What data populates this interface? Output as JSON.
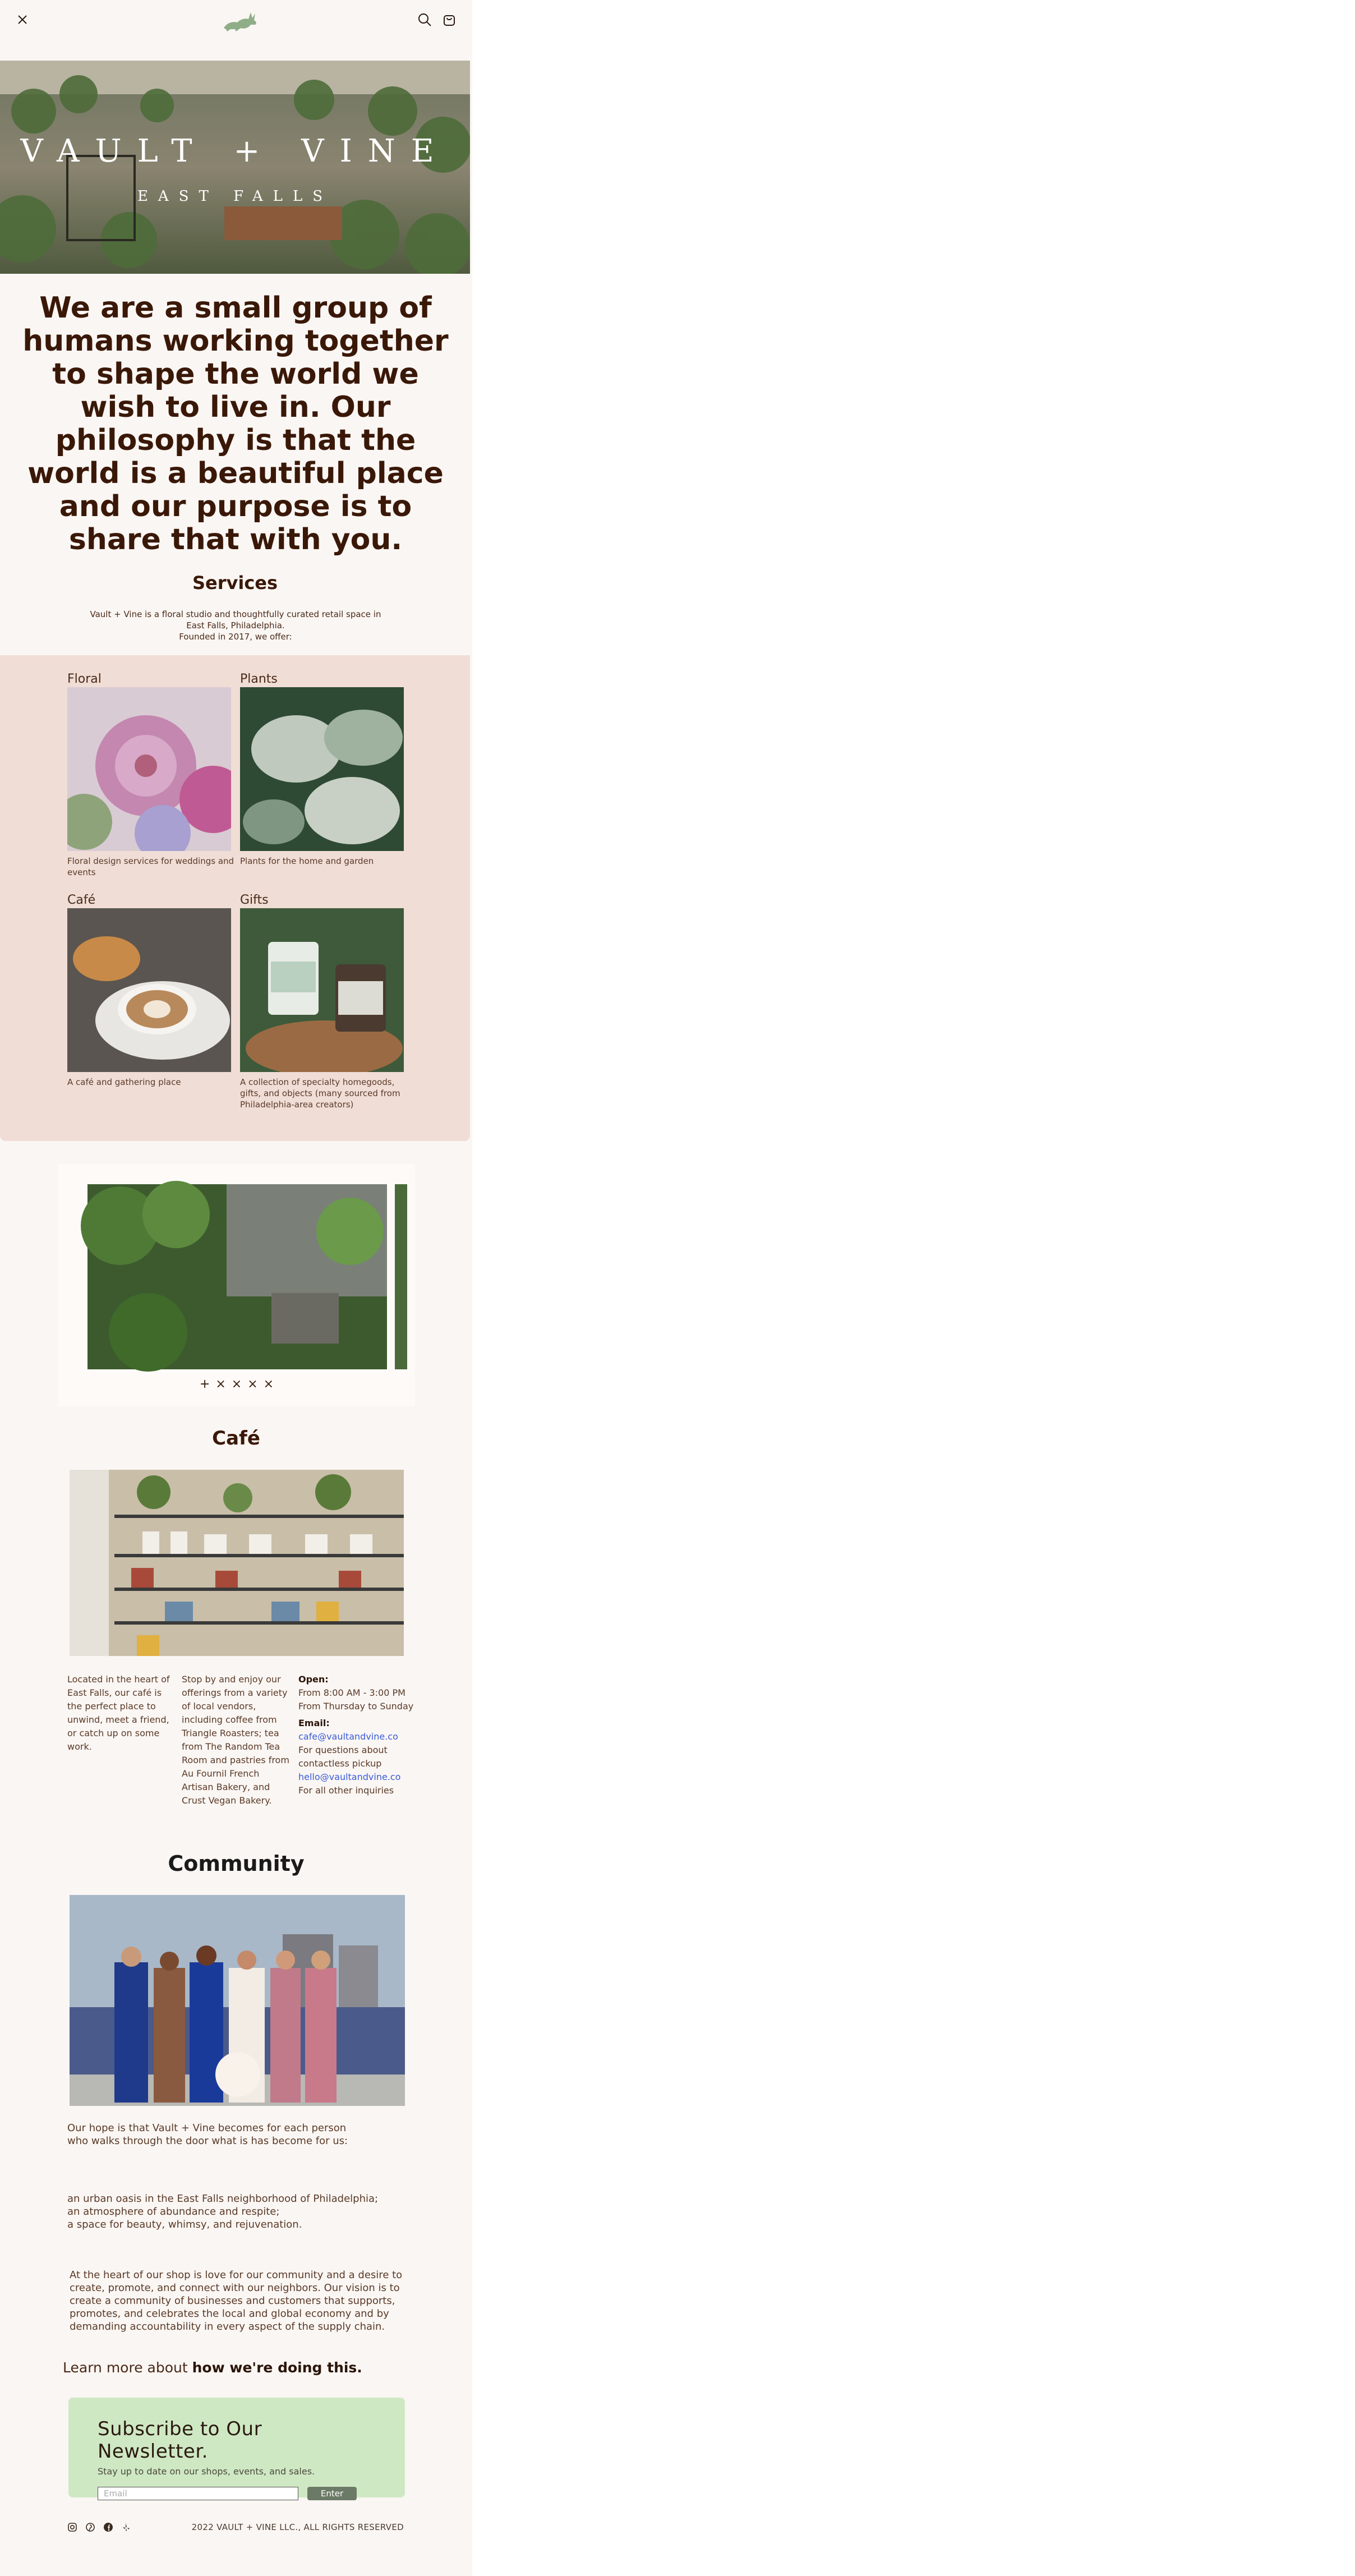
{
  "header": {
    "logo": "rabbit-logo",
    "menu_icon": "close-icon",
    "search_icon": "search-icon",
    "cart_icon": "cart-icon"
  },
  "hero": {
    "title": "VAULT + VINE",
    "subtitle": "EAST FALLS"
  },
  "mission": "We are a small group of humans working together to shape the world we wish to live in. Our philosophy is that the world is a beautiful place and our purpose is to share that with you.",
  "services": {
    "title": "Services",
    "intro_line1": "Vault + Vine is a floral studio and thoughtfully curated retail space in",
    "intro_line2": "East Falls, Philadelphia.",
    "intro_line3": "Founded in 2017, we offer:",
    "items": [
      {
        "label": "Floral",
        "desc": "Floral design services for weddings and events"
      },
      {
        "label": "Plants",
        "desc": "Plants for the home and garden"
      },
      {
        "label": "Café",
        "desc": "A café and gathering place"
      },
      {
        "label": "Gifts",
        "desc": "A collection of specialty homegoods, gifts, and objects (many sourced from Philadelphia-area creators)"
      }
    ]
  },
  "gallery": {
    "dots": [
      "+",
      "×",
      "×",
      "×",
      "×"
    ]
  },
  "cafe": {
    "title": "Café",
    "col1": "Located in the heart of East Falls, our café is the perfect place to unwind, meet a friend, or catch up on some work.",
    "col2": "Stop by and enjoy our offerings from a variety of local vendors, including coffee from Triangle Roasters; tea from The Random Tea Room and pastries from Au Fournil French Artisan Bakery, and Crust Vegan Bakery.",
    "open_label": "Open:",
    "hours1": "From 8:00 AM - 3:00 PM",
    "hours2": "From Thursday to Sunday",
    "email_label": "Email:",
    "email1": "cafe@vaultandvine.co",
    "email1_note": "For questions about contactless pickup",
    "email2": "hello@vaultandvine.co",
    "email2_note": "For all other inquiries"
  },
  "community": {
    "title": "Community",
    "p1_line1": "Our hope is that Vault + Vine becomes for each person",
    "p1_line2": "who walks through the door what is has become for us:",
    "p2_line1": "an urban oasis in the East Falls neighborhood of Philadelphia;",
    "p2_line2": "an atmosphere of abundance and respite;",
    "p2_line3": "a space for beauty, whimsy, and rejuvenation.",
    "p3": "At the heart of our shop is love for our community and a desire to create, promote, and connect with our neighbors. Our vision is to create a community of businesses and customers that supports, promotes, and celebrates the local and global economy and by demanding accountability in every aspect of the supply chain.",
    "learn_prefix": "Learn more about",
    "learn_link": "how we're doing this."
  },
  "newsletter": {
    "title": "Subscribe to Our Newsletter.",
    "subtitle": "Stay up to date on our shops, events, and sales.",
    "placeholder": "Email",
    "button": "Enter"
  },
  "footer": {
    "socials": [
      "instagram-icon",
      "pinterest-icon",
      "facebook-icon",
      "yelp-icon"
    ],
    "copyright": "2022 VAULT + VINE LLC., ALL RIGHTS RESERVED"
  },
  "colors": {
    "background": "#faf6f3",
    "services_bg": "#f0ddd6",
    "newsletter_bg": "#cfe8c4",
    "text": "#3a1808",
    "link": "#3a5bd9"
  }
}
